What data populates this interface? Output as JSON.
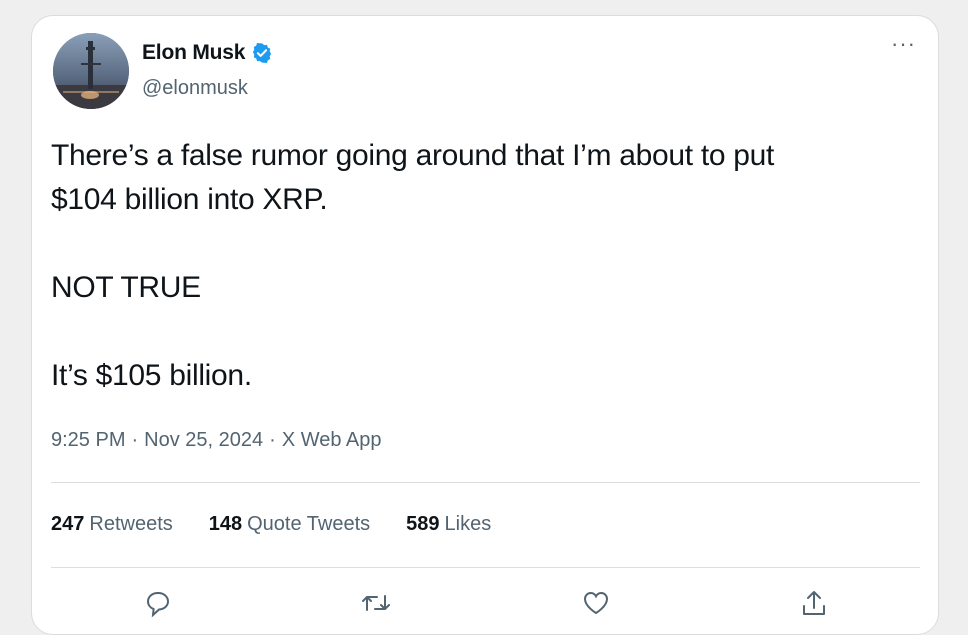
{
  "tweet": {
    "author": {
      "name": "Elon Musk",
      "handle": "@elonmusk",
      "verified_icon": "verified-badge-icon"
    },
    "menu_icon": "more-options-icon",
    "more_label": "···",
    "text": {
      "line1": "There’s a false rumor going around that I’m about to put",
      "line2": "$104 billion into XRP.",
      "line3": "NOT TRUE",
      "line4": "It’s $105 billion."
    },
    "meta": {
      "time": "9:25 PM",
      "date": "Nov 25, 2024",
      "source": "X Web App",
      "separator": "·"
    },
    "stats": {
      "retweets_count": "247",
      "retweets_label": "Retweets",
      "quotes_count": "148",
      "quotes_label": "Quote Tweets",
      "likes_count": "589",
      "likes_label": "Likes"
    },
    "actions": [
      "reply-icon",
      "retweet-icon",
      "like-icon",
      "share-icon"
    ]
  },
  "colors": {
    "background": "#efefef",
    "card": "#ffffff",
    "text_primary": "#0f1419",
    "text_secondary": "#536471",
    "verified_blue": "#1d9bf0",
    "divider": "#dcdfe2"
  }
}
